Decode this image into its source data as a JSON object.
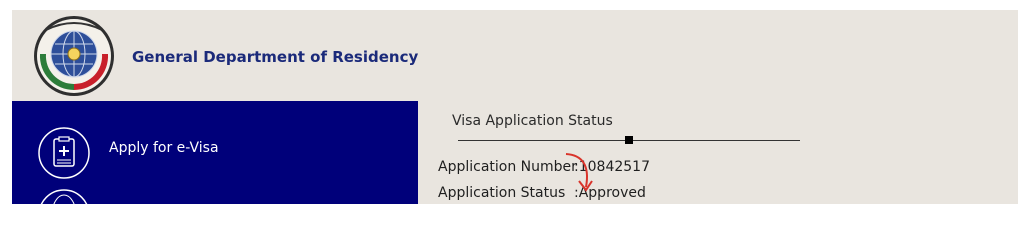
{
  "header": {
    "title": "General Department of Residency",
    "logo_text": "الجنسية والجوازات"
  },
  "sidebar": {
    "items": [
      {
        "label": "Apply for e-Visa",
        "icon": "visa-document-icon"
      },
      {
        "label": "",
        "icon": "globe-icon"
      }
    ]
  },
  "main": {
    "section_title": "Visa Application Status",
    "application_number": {
      "label": "Application Number",
      "separator": ":",
      "value": "10842517"
    },
    "application_status": {
      "label": "Application Status",
      "separator": ":",
      "value": "Approved"
    }
  },
  "colors": {
    "sidebar_bg": "#00007a",
    "title_color": "#1b2a7a",
    "background": "#e9e5df",
    "annotation_arrow": "#d9342b"
  }
}
